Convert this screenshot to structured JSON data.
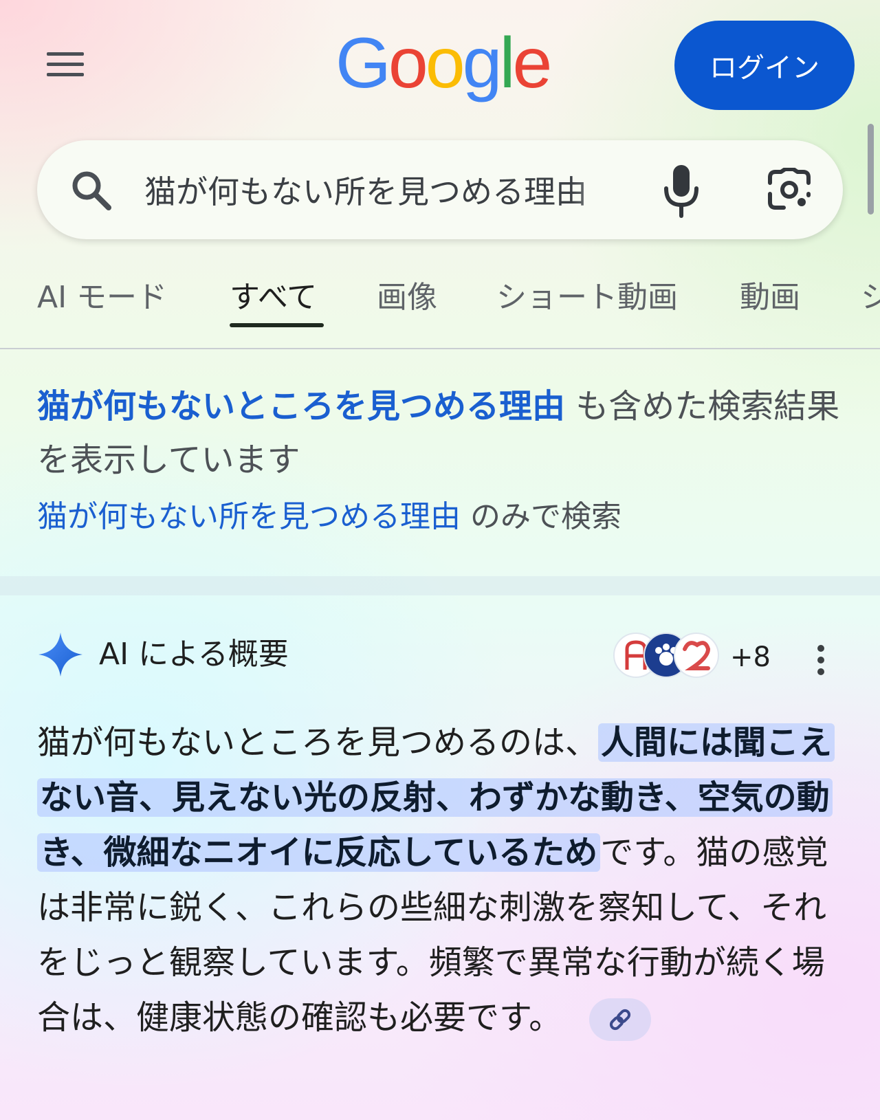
{
  "header": {
    "menu_icon": "hamburger-menu-icon",
    "logo_letters": [
      {
        "char": "G",
        "color": "#4285F4"
      },
      {
        "char": "o",
        "color": "#EA4335"
      },
      {
        "char": "o",
        "color": "#FBBC05"
      },
      {
        "char": "g",
        "color": "#4285F4"
      },
      {
        "char": "l",
        "color": "#34A853"
      },
      {
        "char": "e",
        "color": "#EA4335"
      }
    ],
    "login_label": "ログイン"
  },
  "search": {
    "query": "猫が何もない所を見つめる理由",
    "icons": [
      "search-icon",
      "microphone-icon",
      "google-lens-icon"
    ]
  },
  "tabs": [
    {
      "label": "AI モード"
    },
    {
      "label": "すべて",
      "active": true
    },
    {
      "label": "画像"
    },
    {
      "label": "ショート動画"
    },
    {
      "label": "動画"
    },
    {
      "label": "シ"
    }
  ],
  "spelling": {
    "corrected_query": "猫が何もないところを見つめる理由",
    "corrected_suffix": " も含めた検索結果を表示しています",
    "original_query": "猫が何もない所を見つめる理由",
    "original_suffix": " のみで検索"
  },
  "ai_overview": {
    "title": "AI による概要",
    "source_count": "+8",
    "text_before": "猫が何もないところを見つめるのは、",
    "text_highlight": "人間には聞こえない音、見えない光の反射、わずかな動き、空気の動き、微細なニオイに反応しているため",
    "text_after": "です。猫の感覚は非常に鋭く、これらの些細な刺激を察知して、それをじっと観察しています。頻繁で異常な行動が続く場合は、健康状態の確認も必要です。",
    "link_icon": "link-icon"
  },
  "colors": {
    "accent": "#0b57d0",
    "link": "#1a5fd0",
    "highlight": "#b9cdff"
  }
}
